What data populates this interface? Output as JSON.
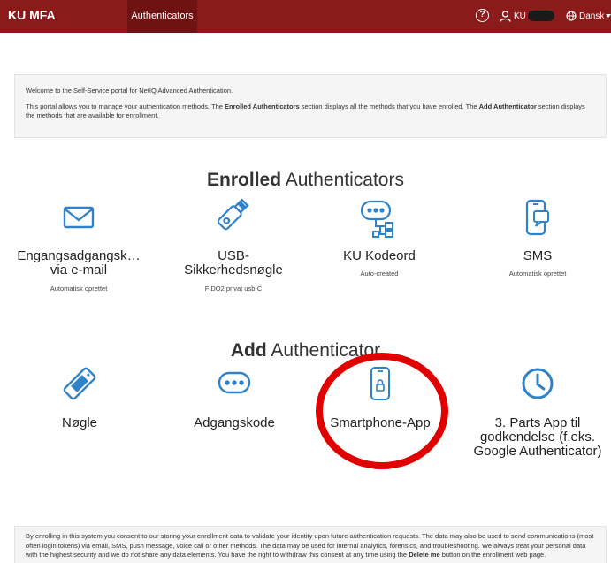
{
  "header": {
    "brand": "KU MFA",
    "tab": "Authenticators",
    "help_icon": "?",
    "user": "KU",
    "language": "Dansk"
  },
  "welcome": {
    "line1": "Welcome to the Self-Service portal for NetIQ Advanced Authentication.",
    "line2_a": "This portal allows you to manage your authentication methods. The ",
    "line2_b": "Enrolled Authenticators",
    "line2_c": " section displays all the methods that you have enrolled. The ",
    "line2_d": "Add Authenticator",
    "line2_e": " section displays the methods that are available for enrollment."
  },
  "enrolled": {
    "heading_bold": "Enrolled",
    "heading_rest": " Authenticators",
    "items": [
      {
        "name": "Engangsadgangsk…\nvia e-mail",
        "sub": "Automatisk oprettet",
        "icon": "envelope-icon"
      },
      {
        "name": "USB-\nSikkerhedsnøgle",
        "sub": "FIDO2 privat usb-C",
        "icon": "usb-key-icon"
      },
      {
        "name": "KU Kodeord",
        "sub": "Auto-created",
        "icon": "password-network-icon"
      },
      {
        "name": "SMS",
        "sub": "Automatisk oprettet",
        "icon": "sms-phone-icon"
      }
    ]
  },
  "add": {
    "heading_bold": "Add",
    "heading_rest": " Authenticator",
    "items": [
      {
        "name": "Nøgle",
        "icon": "hardware-token-icon"
      },
      {
        "name": "Adgangskode",
        "icon": "password-icon"
      },
      {
        "name": "Smartphone-App",
        "icon": "smartphone-lock-icon"
      },
      {
        "name": "3. Parts App til\ngodkendelse (f.eks.\nGoogle Authenticator)",
        "icon": "clock-icon"
      }
    ]
  },
  "consent": {
    "text_a": "By enrolling in this system you consent to our storing your enrollment data to validate your identity upon future authentication requests. The data may also be used to send communications (most often login tokens) via email, SMS, push message, voice call or other methods. The data may be used for internal analytics, forensics, and troubleshooting. We always treat your personal data with the highest security and we do not share any data elements. You have the right to withdraw this consent at any time using the ",
    "text_b": "Delete me",
    "text_c": " button on the enrollment web page."
  },
  "colors": {
    "header_bg": "#8b1a1a",
    "icon_blue": "#2f82c8",
    "annotation_red": "#e00000"
  }
}
